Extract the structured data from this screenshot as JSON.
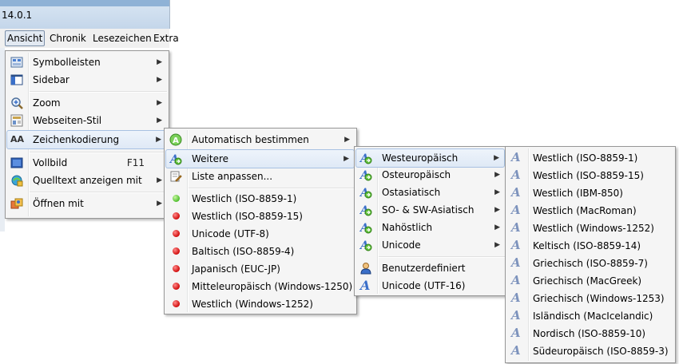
{
  "window": {
    "title": "14.0.1"
  },
  "menubar": {
    "items": [
      {
        "label": "Ansicht"
      },
      {
        "label": "Chronik"
      },
      {
        "label": "Lesezeichen"
      },
      {
        "label": "Extra"
      }
    ]
  },
  "view_menu": {
    "items": [
      {
        "label": "Symbolleisten",
        "icon": "toolbars-icon",
        "submenu": true
      },
      {
        "label": "Sidebar",
        "icon": "sidebar-icon",
        "submenu": true
      },
      {
        "label": "Zoom",
        "icon": "zoom-icon",
        "submenu": true
      },
      {
        "label": "Webseiten-Stil",
        "icon": "page-style-icon",
        "submenu": true
      },
      {
        "label": "Zeichenkodierung",
        "icon": "character-encoding-icon",
        "submenu": true,
        "highlighted": true
      },
      {
        "label": "Vollbild",
        "icon": "fullscreen-icon",
        "shortcut": "F11"
      },
      {
        "label": "Quelltext anzeigen mit",
        "icon": "view-source-icon",
        "submenu": true
      },
      {
        "label": "Öffnen mit",
        "icon": "open-with-icon",
        "submenu": true
      }
    ]
  },
  "encoding_menu": {
    "items": [
      {
        "label": "Automatisch bestimmen",
        "icon": "auto-detect-icon",
        "submenu": true
      },
      {
        "label": "Weitere",
        "icon": "more-encodings-icon",
        "submenu": true,
        "highlighted": true
      },
      {
        "label": "Liste anpassen...",
        "icon": "customize-list-icon"
      },
      {
        "label": "Westlich (ISO-8859-1)",
        "state": "selected"
      },
      {
        "label": "Westlich (ISO-8859-15)",
        "state": "unselected"
      },
      {
        "label": "Unicode (UTF-8)",
        "state": "unselected"
      },
      {
        "label": "Baltisch (ISO-8859-4)",
        "state": "unselected"
      },
      {
        "label": "Japanisch (EUC-JP)",
        "state": "unselected"
      },
      {
        "label": "Mitteleuropäisch (Windows-1250)",
        "state": "unselected"
      },
      {
        "label": "Westlich (Windows-1252)",
        "state": "unselected"
      }
    ]
  },
  "more_menu": {
    "items": [
      {
        "label": "Westeuropäisch",
        "submenu": true,
        "highlighted": true
      },
      {
        "label": "Osteuropäisch",
        "submenu": true
      },
      {
        "label": "Ostasiatisch",
        "submenu": true
      },
      {
        "label": "SO- & SW-Asiatisch",
        "submenu": true
      },
      {
        "label": "Nahöstlich",
        "submenu": true
      },
      {
        "label": "Unicode",
        "submenu": true
      },
      {
        "label": "Benutzerdefiniert"
      },
      {
        "label": "Unicode (UTF-16)"
      }
    ]
  },
  "west_menu": {
    "items": [
      {
        "label": "Westlich (ISO-8859-1)"
      },
      {
        "label": "Westlich (ISO-8859-15)"
      },
      {
        "label": "Westlich (IBM-850)"
      },
      {
        "label": "Westlich (MacRoman)"
      },
      {
        "label": "Westlich (Windows-1252)"
      },
      {
        "label": "Keltisch (ISO-8859-14)"
      },
      {
        "label": "Griechisch (ISO-8859-7)"
      },
      {
        "label": "Griechisch (MacGreek)"
      },
      {
        "label": "Griechisch (Windows-1253)"
      },
      {
        "label": "Isländisch (MacIcelandic)"
      },
      {
        "label": "Nordisch (ISO-8859-10)"
      },
      {
        "label": "Südeuropäisch (ISO-8859-3)"
      }
    ]
  },
  "colors": {
    "highlight": "#dfe9f6",
    "selected_bullet": "#4fbf2d",
    "unselected_bullet": "#d10b0b",
    "encoding_icon": "#3a6fc9"
  }
}
